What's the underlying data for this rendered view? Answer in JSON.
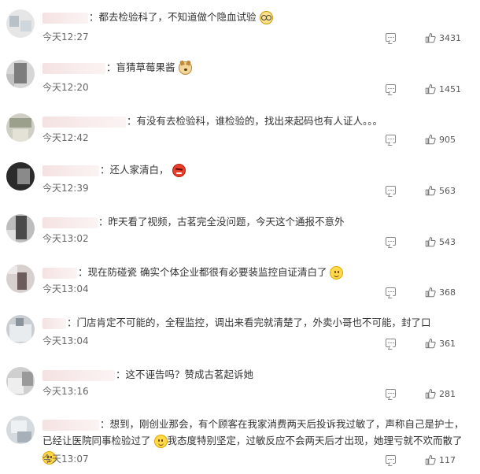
{
  "comments": [
    {
      "text_after": "都去检验科了，不知道做个隐血试验",
      "emoji": "glasses-emoji",
      "time": "今天12:27",
      "likes": "3431"
    },
    {
      "text_after": "盲猜草莓果酱",
      "emoji": "dog-emoji",
      "time": "今天12:20",
      "likes": "1451"
    },
    {
      "text_after": "有没有去检验科，谁检验的，找出来起码也有人证人。。。",
      "time": "今天12:42",
      "likes": "905"
    },
    {
      "text_after": "还人家清白，",
      "emoji": "angry-emoji",
      "time": "今天12:39",
      "likes": "563"
    },
    {
      "text_after": "昨天看了视频，古茗完全没问题，今天这个通报不意外",
      "time": "今天13:02",
      "likes": "543"
    },
    {
      "text_after": "现在防碰瓷 确实个体企业都很有必要装监控自证清白了",
      "emoji": "smile-emoji",
      "time": "今天13:04",
      "likes": "368"
    },
    {
      "text_after": "门店肯定不可能的，全程监控，调出来看完就清楚了，外卖小哥也不可能，封了口",
      "time": "今天13:04",
      "likes": "361"
    },
    {
      "text_after": "这不诬告吗？赞成古茗起诉她",
      "time": "今天13:16",
      "likes": "281"
    },
    {
      "text_after": "想到，刚创业那会，有个顾客在我家消费两天后投诉我过敏了，声称自己是护士，已经让医院同事检验过了",
      "text_after_2": "我态度特别坚定，过敏反应不会两天后才出现，她理亏就不欢而散了",
      "time": "今天13:07",
      "likes": "117"
    }
  ],
  "icons": {
    "reply": "comment-icon",
    "like": "thumbs-up-icon"
  },
  "colors": {
    "text": "#333333",
    "time": "#666666",
    "icon": "#888888",
    "username_blur": "#f4e2e2"
  }
}
